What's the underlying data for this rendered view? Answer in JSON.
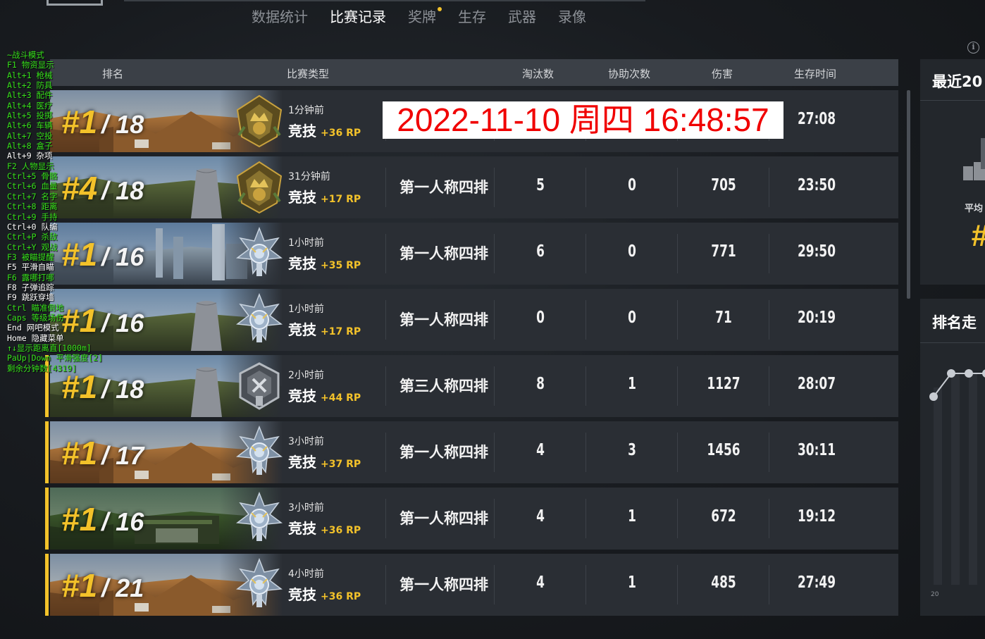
{
  "nav": {
    "tabs": [
      {
        "label": "数据统计",
        "active": false,
        "dot": false
      },
      {
        "label": "比赛记录",
        "active": true,
        "dot": false
      },
      {
        "label": "奖牌",
        "active": false,
        "dot": true
      },
      {
        "label": "生存",
        "active": false,
        "dot": false
      },
      {
        "label": "武器",
        "active": false,
        "dot": false
      },
      {
        "label": "录像",
        "active": false,
        "dot": false
      }
    ],
    "info_icon": "info-icon",
    "info_glyph": "i"
  },
  "table": {
    "headers": {
      "rank": "排名",
      "match_type": "比赛类型",
      "kills": "淘汰数",
      "assists": "协助次数",
      "damage": "伤害",
      "survival": "生存时间"
    },
    "rows": [
      {
        "rank": "#1",
        "total": "/ 18",
        "time_ago": "1分钟前",
        "mode": "竞技",
        "rp": "+36 RP",
        "type": "",
        "kills": "",
        "assists": "",
        "damage": "",
        "survival": "27:08",
        "badge": "crown-medal-icon",
        "map": "desert",
        "fpp": false
      },
      {
        "rank": "#4",
        "total": "/ 18",
        "time_ago": "31分钟前",
        "mode": "竞技",
        "rp": "+17 RP",
        "type": "第一人称四排",
        "kills": "5",
        "assists": "0",
        "damage": "705",
        "survival": "23:50",
        "badge": "crown-medal-icon",
        "map": "erangel",
        "fpp": false
      },
      {
        "rank": "#1",
        "total": "/ 16",
        "time_ago": "1小时前",
        "mode": "竞技",
        "rp": "+35 RP",
        "type": "第一人称四排",
        "kills": "6",
        "assists": "0",
        "damage": "771",
        "survival": "29:50",
        "badge": "diamond-medal-icon",
        "map": "snow",
        "fpp": false
      },
      {
        "rank": "#1",
        "total": "/ 16",
        "time_ago": "1小时前",
        "mode": "竞技",
        "rp": "+17 RP",
        "type": "第一人称四排",
        "kills": "0",
        "assists": "0",
        "damage": "71",
        "survival": "20:19",
        "badge": "diamond-medal-icon",
        "map": "erangel",
        "fpp": false
      },
      {
        "rank": "#1",
        "total": "/ 18",
        "time_ago": "2小时前",
        "mode": "竞技",
        "rp": "+44 RP",
        "type": "第三人称四排",
        "kills": "8",
        "assists": "1",
        "damage": "1127",
        "survival": "28:07",
        "badge": "platinum-medal-icon",
        "map": "erangel",
        "fpp": true
      },
      {
        "rank": "#1",
        "total": "/ 17",
        "time_ago": "3小时前",
        "mode": "竞技",
        "rp": "+37 RP",
        "type": "第一人称四排",
        "kills": "4",
        "assists": "3",
        "damage": "1456",
        "survival": "30:11",
        "badge": "diamond-medal-icon",
        "map": "desert",
        "fpp": true
      },
      {
        "rank": "#1",
        "total": "/ 16",
        "time_ago": "3小时前",
        "mode": "竞技",
        "rp": "+36 RP",
        "type": "第一人称四排",
        "kills": "4",
        "assists": "1",
        "damage": "672",
        "survival": "19:12",
        "badge": "diamond-medal-icon",
        "map": "jungle",
        "fpp": true
      },
      {
        "rank": "#1",
        "total": "/ 21",
        "time_ago": "4小时前",
        "mode": "竞技",
        "rp": "+36 RP",
        "type": "第一人称四排",
        "kills": "4",
        "assists": "1",
        "damage": "485",
        "survival": "27:49",
        "badge": "diamond-medal-icon",
        "map": "desert",
        "fpp": true
      }
    ]
  },
  "timestamp": "2022-11-10 周四 16:48:57",
  "cheat_menu": [
    {
      "text": "~战斗模式",
      "white": false
    },
    {
      "text": "F1 物资显示",
      "white": false
    },
    {
      "text": "Alt+1 枪械",
      "white": false
    },
    {
      "text": "Alt+2 防具",
      "white": false
    },
    {
      "text": "Alt+3 配件",
      "white": false
    },
    {
      "text": "Alt+4 医疗",
      "white": false
    },
    {
      "text": "Alt+5 投掷",
      "white": false
    },
    {
      "text": "Alt+6 车辆",
      "white": false
    },
    {
      "text": "Alt+7 空投",
      "white": false
    },
    {
      "text": "Alt+8 盒子",
      "white": false
    },
    {
      "text": "Alt+9 杂项",
      "white": true
    },
    {
      "text": "F2 人物显示",
      "white": false
    },
    {
      "text": "Ctrl+5 骨骼",
      "white": false
    },
    {
      "text": "Ctrl+6 血量",
      "white": false
    },
    {
      "text": "Ctrl+7 名字",
      "white": false
    },
    {
      "text": "Ctrl+8 距离",
      "white": false
    },
    {
      "text": "Ctrl+9 手持",
      "white": false
    },
    {
      "text": "Ctrl+0 队编",
      "white": true
    },
    {
      "text": "Ctrl+P 杀敌",
      "white": false
    },
    {
      "text": "Ctrl+Y 观战",
      "white": false
    },
    {
      "text": "F3 被瞄提醒",
      "white": false
    },
    {
      "text": "F5 平滑自瞄",
      "white": true
    },
    {
      "text": "F6 露哪打哪",
      "white": false
    },
    {
      "text": "F8 子弹追踪",
      "white": true
    },
    {
      "text": "F9 跳跃穿墙",
      "white": true
    },
    {
      "text": "Ctrl 瞄准倒地",
      "white": false
    },
    {
      "text": "Caps 等级场伤",
      "white": false
    },
    {
      "text": "End 网吧模式",
      "white": true
    },
    {
      "text": "Home 隐藏菜单",
      "white": true
    },
    {
      "text": "↑↓显示距离直[1000m]",
      "white": false
    },
    {
      "text": "PaUp|Down 平滑强度[2]",
      "white": false
    },
    {
      "text": "剩余分钟数[4319]",
      "white": false
    }
  ],
  "right_panel": {
    "recent_title": "最近20",
    "avg_label": "平均",
    "avg_value": "#",
    "trend_title": "排名走",
    "axis_label": "20"
  },
  "colors": {
    "accent": "#f3c22a",
    "timestamp_text": "#f00000",
    "cheat_green": "#38e21c"
  }
}
